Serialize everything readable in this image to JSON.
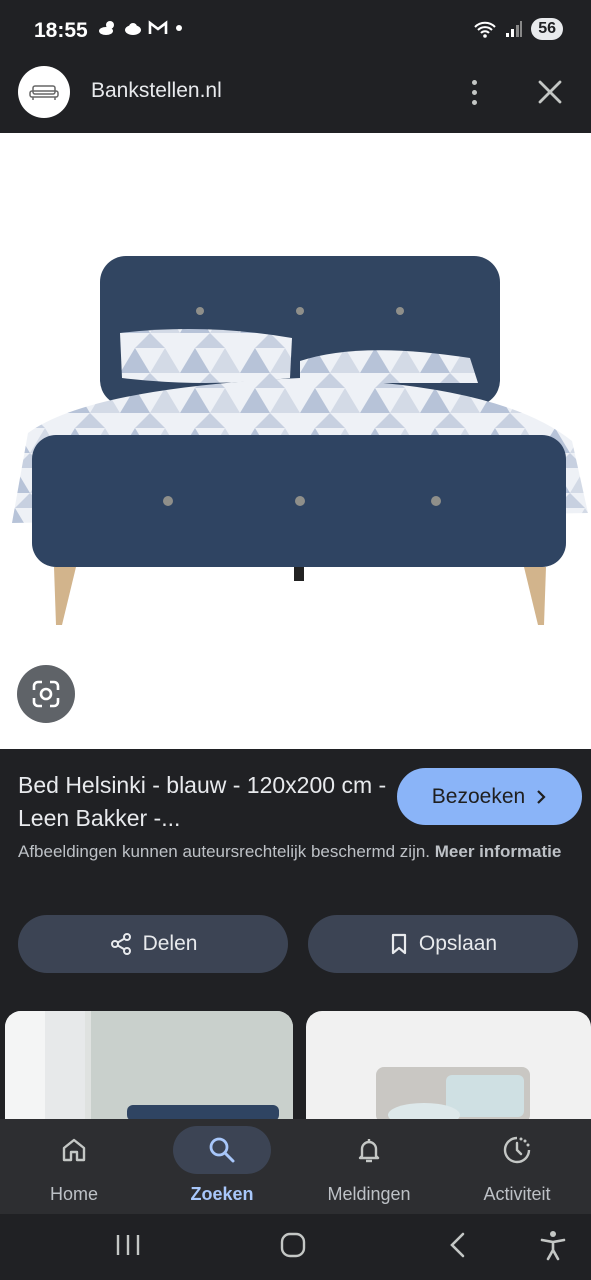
{
  "status_bar": {
    "time": "18:55",
    "battery": "56",
    "icons": [
      "weather-icon",
      "cloud-icon",
      "gmail-icon",
      "dot-icon",
      "wifi-icon",
      "signal-icon"
    ]
  },
  "header": {
    "site_name": "Bankstellen.nl"
  },
  "result": {
    "title": "Bed Helsinki - blauw - 120x200 cm - Leen Bakker -...",
    "visit_label": "Bezoeken",
    "copyright_text": "Afbeeldingen kunnen auteursrechtelijk beschermd zijn.",
    "more_info_label": "Meer informatie",
    "share_label": "Delen",
    "save_label": "Opslaan"
  },
  "bottom_nav": {
    "items": [
      {
        "label": "Home",
        "icon": "home-icon"
      },
      {
        "label": "Zoeken",
        "icon": "search-icon",
        "active": true
      },
      {
        "label": "Meldingen",
        "icon": "bell-icon"
      },
      {
        "label": "Activiteit",
        "icon": "activity-icon"
      }
    ]
  },
  "colors": {
    "background": "#202124",
    "accent": "#8ab4f8",
    "pill": "#3c4454",
    "active_label": "#a8c7fa"
  }
}
